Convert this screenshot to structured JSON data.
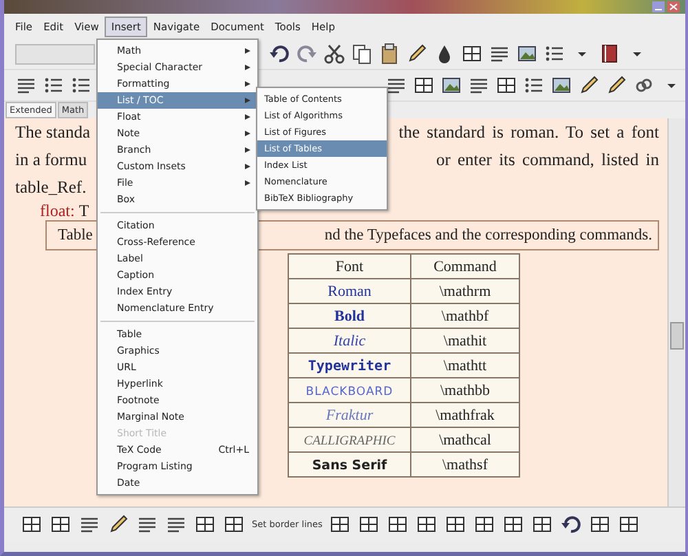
{
  "menubar": [
    {
      "label": "File",
      "selected": false
    },
    {
      "label": "Edit",
      "selected": false
    },
    {
      "label": "View",
      "selected": false
    },
    {
      "label": "Insert",
      "selected": true
    },
    {
      "label": "Navigate",
      "selected": false
    },
    {
      "label": "Document",
      "selected": false
    },
    {
      "label": "Tools",
      "selected": false
    },
    {
      "label": "Help",
      "selected": false
    }
  ],
  "tabs": [
    {
      "label": "Extended",
      "selected": true
    },
    {
      "label": "Math",
      "selected": false
    }
  ],
  "document": {
    "lines": [
      {
        "left": "The standa",
        "right": "the standard is roman. To set a font"
      },
      {
        "left": "in a formu",
        "right": "or enter its command, listed in"
      },
      {
        "left": "table_Ref."
      }
    ],
    "float": {
      "label": "float:",
      "text": "T"
    },
    "caption": {
      "left": "Table",
      "right": "nd the Typefaces and the corresponding commands."
    },
    "table": {
      "columns": [
        "Font",
        "Command"
      ],
      "rows": [
        {
          "font": "Roman",
          "command": "\\mathrm",
          "kind": "roman"
        },
        {
          "font": "Bold",
          "command": "\\mathbf",
          "kind": "bold"
        },
        {
          "font": "Italic",
          "command": "\\mathit",
          "kind": "italic"
        },
        {
          "font": "Typewriter",
          "command": "\\mathtt",
          "kind": "typewriter"
        },
        {
          "font": "BLACKBOARD",
          "command": "\\mathbb",
          "kind": "blackboard"
        },
        {
          "font": "Fraktur",
          "command": "\\mathfrak",
          "kind": "fraktur"
        },
        {
          "font": "CALLIGRAPHIC",
          "command": "\\mathcal",
          "kind": "calligraphic"
        },
        {
          "font": "Sans Serif",
          "command": "\\mathsf",
          "kind": "sans"
        }
      ]
    }
  },
  "insert_menu": {
    "items": [
      {
        "kind": "submenu",
        "label": "Math",
        "selected": false,
        "disabled": false
      },
      {
        "kind": "submenu",
        "label": "Special Character",
        "selected": false,
        "disabled": false
      },
      {
        "kind": "submenu",
        "label": "Formatting",
        "selected": false,
        "disabled": false
      },
      {
        "kind": "submenu",
        "label": "List / TOC",
        "selected": true,
        "disabled": false
      },
      {
        "kind": "submenu",
        "label": "Float",
        "selected": false,
        "disabled": false
      },
      {
        "kind": "submenu",
        "label": "Note",
        "selected": false,
        "disabled": false
      },
      {
        "kind": "submenu",
        "label": "Branch",
        "selected": false,
        "disabled": false
      },
      {
        "kind": "submenu",
        "label": "Custom Insets",
        "selected": false,
        "disabled": false
      },
      {
        "kind": "submenu",
        "label": "File",
        "selected": false,
        "disabled": false
      },
      {
        "kind": "item",
        "label": "Box",
        "selected": false,
        "disabled": false
      },
      {
        "kind": "separator"
      },
      {
        "kind": "item",
        "label": "Citation",
        "selected": false,
        "disabled": false
      },
      {
        "kind": "item",
        "label": "Cross-Reference",
        "selected": false,
        "disabled": false
      },
      {
        "kind": "item",
        "label": "Label",
        "selected": false,
        "disabled": false
      },
      {
        "kind": "item",
        "label": "Caption",
        "selected": false,
        "disabled": false
      },
      {
        "kind": "item",
        "label": "Index Entry",
        "selected": false,
        "disabled": false
      },
      {
        "kind": "item",
        "label": "Nomenclature Entry",
        "selected": false,
        "disabled": false
      },
      {
        "kind": "separator"
      },
      {
        "kind": "item",
        "label": "Table",
        "selected": false,
        "disabled": false
      },
      {
        "kind": "item",
        "label": "Graphics",
        "selected": false,
        "disabled": false
      },
      {
        "kind": "item",
        "label": "URL",
        "selected": false,
        "disabled": false
      },
      {
        "kind": "item",
        "label": "Hyperlink",
        "selected": false,
        "disabled": false
      },
      {
        "kind": "item",
        "label": "Footnote",
        "selected": false,
        "disabled": false
      },
      {
        "kind": "item",
        "label": "Marginal Note",
        "selected": false,
        "disabled": false
      },
      {
        "kind": "item",
        "label": "Short Title",
        "selected": false,
        "disabled": true
      },
      {
        "kind": "item",
        "label": "TeX Code",
        "shortcut": "Ctrl+L",
        "selected": false,
        "disabled": false
      },
      {
        "kind": "item",
        "label": "Program Listing",
        "selected": false,
        "disabled": false
      },
      {
        "kind": "item",
        "label": "Date",
        "selected": false,
        "disabled": false
      }
    ]
  },
  "list_toc_submenu": {
    "items": [
      {
        "label": "Table of Contents",
        "selected": false
      },
      {
        "label": "List of Algorithms",
        "selected": false
      },
      {
        "label": "List of Figures",
        "selected": false
      },
      {
        "label": "List of Tables",
        "selected": true
      },
      {
        "label": "Index List",
        "selected": false
      },
      {
        "label": "Nomenclature",
        "selected": false
      },
      {
        "label": "BibTeX Bibliography",
        "selected": false
      }
    ]
  },
  "table_toolbar": {
    "label": "Set border lines"
  }
}
